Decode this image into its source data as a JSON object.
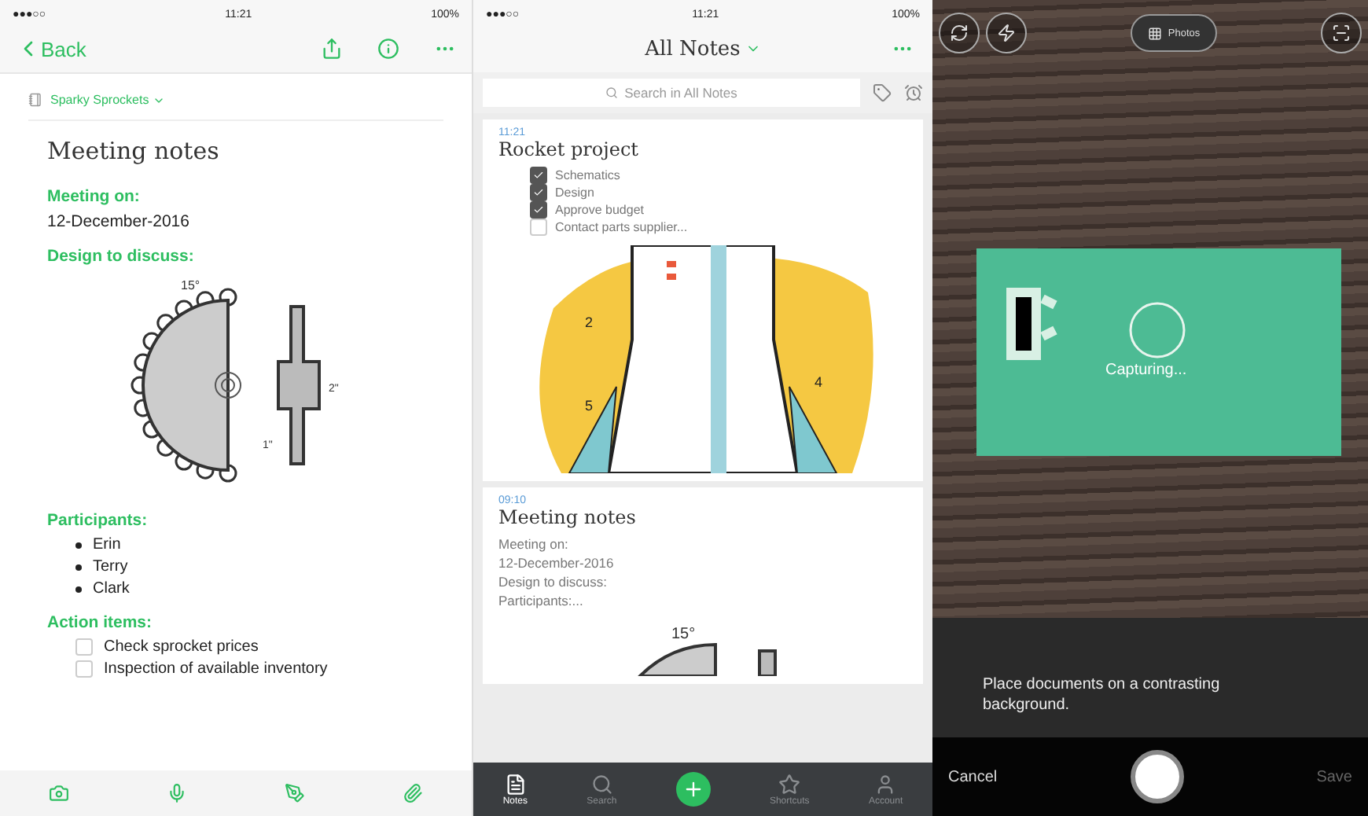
{
  "note_screen": {
    "status": {
      "signal": "●●●○○",
      "time": "11:21",
      "battery": "100%"
    },
    "back": "Back",
    "notebook": "Sparky Sprockets",
    "title": "Meeting notes",
    "blocks": [
      {
        "kind": "heading",
        "text": "Meeting on:"
      },
      {
        "kind": "text",
        "text": "12-December-2016"
      },
      {
        "kind": "heading",
        "text": "Design to discuss:"
      },
      {
        "kind": "drawing",
        "labels": [
          "15°",
          "2\"",
          "1\""
        ]
      },
      {
        "kind": "heading",
        "text": "Participants:"
      },
      {
        "kind": "bullets",
        "items": [
          "Erin",
          "Terry",
          "Clark"
        ]
      },
      {
        "kind": "heading",
        "text": "Action items:"
      },
      {
        "kind": "checklist",
        "items": [
          {
            "label": "Check sprocket prices",
            "checked": false
          },
          {
            "label": "Inspection of available inventory",
            "checked": false
          }
        ]
      }
    ]
  },
  "list_screen": {
    "status": {
      "signal": "●●●○○",
      "time": "11:21",
      "battery": "100%"
    },
    "title": "All Notes",
    "search": {
      "placeholder": "Search in All Notes"
    },
    "notes": [
      {
        "kind": "checklist",
        "time": "11:21",
        "title": "Rocket project",
        "items": [
          {
            "label": "Schematics",
            "checked": true
          },
          {
            "label": "Design",
            "checked": true
          },
          {
            "label": "Approve budget",
            "checked": true
          },
          {
            "label": "Contact parts supplier...",
            "checked": false
          }
        ],
        "sketch_labels": [
          "2",
          "5",
          "4"
        ]
      },
      {
        "kind": "preview",
        "time": "09:10",
        "title": "Meeting notes",
        "lines": [
          "Meeting on:",
          "12-December-2016",
          "Design to discuss:",
          "Participants:..."
        ],
        "sketch_labels": [
          "15°"
        ]
      }
    ],
    "tabs": [
      {
        "kind": "tab",
        "label": "Notes",
        "selected": true
      },
      {
        "kind": "tab",
        "label": "Search",
        "selected": false
      },
      {
        "kind": "add"
      },
      {
        "kind": "tab",
        "label": "Shortcuts",
        "selected": false
      },
      {
        "kind": "tab",
        "label": "Account",
        "selected": false
      }
    ]
  },
  "camera_screen": {
    "photos": "Photos",
    "capturing": "Capturing...",
    "hint": "Place documents on a contrasting background.",
    "cancel": "Cancel",
    "save": "Save"
  }
}
